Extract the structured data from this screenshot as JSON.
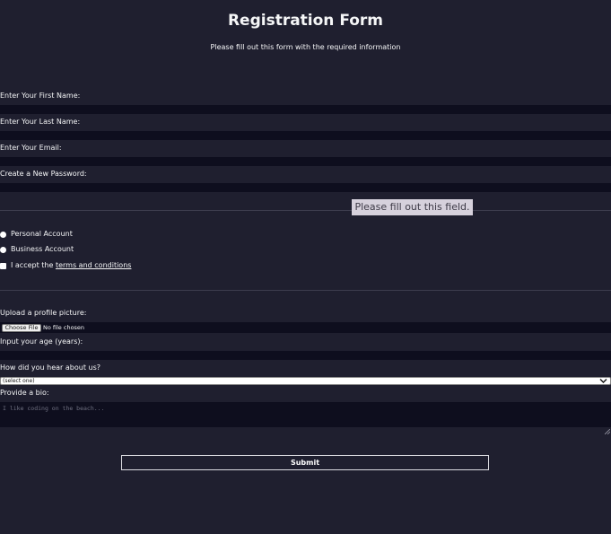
{
  "form": {
    "title": "Registration Form",
    "description": "Please fill out this form with the required information",
    "fields": {
      "first_name_label": "Enter Your First Name:",
      "last_name_label": "Enter Your Last Name:",
      "email_label": "Enter Your Email:",
      "password_label": "Create a New Password:"
    },
    "validation_tooltip": "Please fill out this field.",
    "account_type": {
      "personal_label": "Personal Account",
      "business_label": "Business Account"
    },
    "terms": {
      "prefix": "I accept the",
      "link_text": "terms and conditions"
    },
    "profile_picture": {
      "label": "Upload a profile picture:",
      "button_label": "Choose File",
      "status": "No file chosen"
    },
    "age": {
      "label": "Input your age (years):"
    },
    "referrer": {
      "label": "How did you hear about us?",
      "selected": "(select one)"
    },
    "bio": {
      "label": "Provide a bio:",
      "placeholder": "I like coding on the beach..."
    },
    "submit_label": "Submit"
  },
  "colors": {
    "background": "#1f1f2f",
    "input_background": "#0e0e1e",
    "text": "#f5f6f7",
    "tooltip_background": "#d6d1dc",
    "tooltip_text": "#3d3a46"
  },
  "icons": {
    "select_chevron": "chevron-down-icon",
    "textarea_resize": "resize-grip-icon"
  }
}
